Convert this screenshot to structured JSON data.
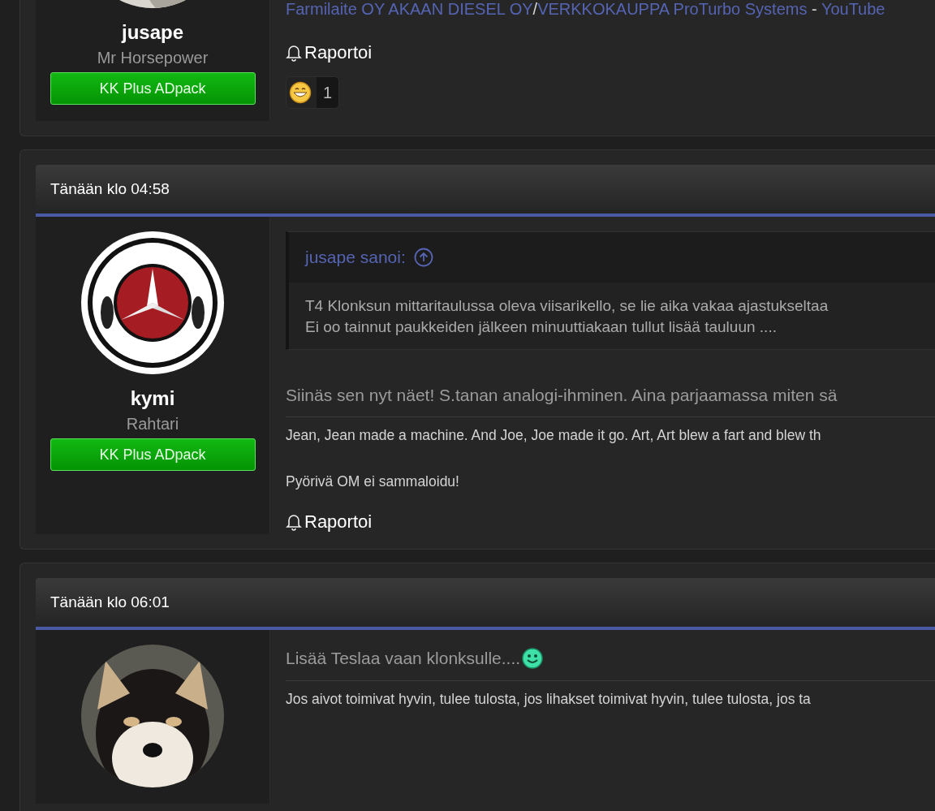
{
  "posts": [
    {
      "author": {
        "name": "jusape",
        "title": "Mr Horsepower",
        "badge": "KK Plus ADpack",
        "avatar": {
          "kind": "picture"
        }
      },
      "body": [
        {
          "kind": "links",
          "parts": [
            {
              "kind": "link",
              "text": "Farmilaite OY AKAAN DIESEL OY"
            },
            {
              "kind": "text",
              "text": "/"
            },
            {
              "kind": "link",
              "text": "VERKKOKAUPPA ProTurbo Systems"
            },
            {
              "kind": "text",
              "text": " - "
            },
            {
              "kind": "link",
              "text": "YouTube"
            }
          ]
        }
      ],
      "report": "Raportoi",
      "reactions": [
        {
          "count": "1"
        }
      ]
    },
    {
      "date": "Tänään klo 04:58",
      "author": {
        "name": "kymi",
        "title": "Rahtari",
        "badge": "KK Plus ADpack",
        "avatar": {
          "kind": "picture"
        }
      },
      "quote": {
        "author": "jusape sanoi:",
        "lines": [
          "T4 Klonksun mittaritaulussa oleva viisarikello, se lie aika vakaa ajastukseltaa",
          "Ei oo tainnut paukkeiden jälkeen minuuttiakaan tullut lisää tauluun ...."
        ]
      },
      "body": [
        {
          "kind": "message",
          "text": "Siinäs sen nyt näet! S.tanan analogi-ihminen. Aina parjaamassa miten sä"
        }
      ],
      "signature": [
        "Jean, Jean made a machine. And Joe, Joe made it go. Art, Art blew a fart and blew th",
        "Pyörivä OM ei sammaloidu!"
      ],
      "report": "Raportoi"
    },
    {
      "date": "Tänään klo 06:01",
      "author": {
        "avatar": {
          "kind": "picture"
        }
      },
      "body": [
        {
          "kind": "message",
          "text": "Lisää Teslaa vaan klonksulle....",
          "emoji": true
        }
      ],
      "signature": [
        "Jos aivot toimivat hyvin, tulee tulosta, jos lihakset toimivat hyvin, tulee tulosta, jos ta"
      ]
    }
  ]
}
